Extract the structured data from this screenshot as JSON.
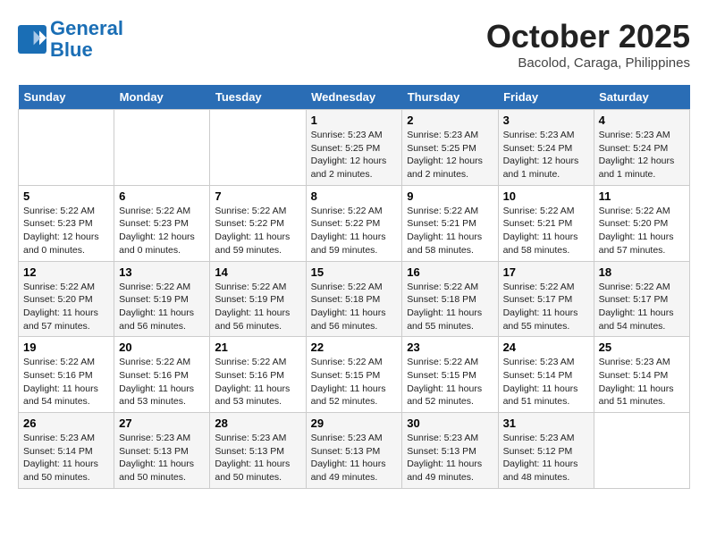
{
  "header": {
    "logo_line1": "General",
    "logo_line2": "Blue",
    "title": "October 2025",
    "subtitle": "Bacolod, Caraga, Philippines"
  },
  "days_of_week": [
    "Sunday",
    "Monday",
    "Tuesday",
    "Wednesday",
    "Thursday",
    "Friday",
    "Saturday"
  ],
  "weeks": [
    [
      {
        "day": "",
        "info": ""
      },
      {
        "day": "",
        "info": ""
      },
      {
        "day": "",
        "info": ""
      },
      {
        "day": "1",
        "info": "Sunrise: 5:23 AM\nSunset: 5:25 PM\nDaylight: 12 hours\nand 2 minutes."
      },
      {
        "day": "2",
        "info": "Sunrise: 5:23 AM\nSunset: 5:25 PM\nDaylight: 12 hours\nand 2 minutes."
      },
      {
        "day": "3",
        "info": "Sunrise: 5:23 AM\nSunset: 5:24 PM\nDaylight: 12 hours\nand 1 minute."
      },
      {
        "day": "4",
        "info": "Sunrise: 5:23 AM\nSunset: 5:24 PM\nDaylight: 12 hours\nand 1 minute."
      }
    ],
    [
      {
        "day": "5",
        "info": "Sunrise: 5:22 AM\nSunset: 5:23 PM\nDaylight: 12 hours\nand 0 minutes."
      },
      {
        "day": "6",
        "info": "Sunrise: 5:22 AM\nSunset: 5:23 PM\nDaylight: 12 hours\nand 0 minutes."
      },
      {
        "day": "7",
        "info": "Sunrise: 5:22 AM\nSunset: 5:22 PM\nDaylight: 11 hours\nand 59 minutes."
      },
      {
        "day": "8",
        "info": "Sunrise: 5:22 AM\nSunset: 5:22 PM\nDaylight: 11 hours\nand 59 minutes."
      },
      {
        "day": "9",
        "info": "Sunrise: 5:22 AM\nSunset: 5:21 PM\nDaylight: 11 hours\nand 58 minutes."
      },
      {
        "day": "10",
        "info": "Sunrise: 5:22 AM\nSunset: 5:21 PM\nDaylight: 11 hours\nand 58 minutes."
      },
      {
        "day": "11",
        "info": "Sunrise: 5:22 AM\nSunset: 5:20 PM\nDaylight: 11 hours\nand 57 minutes."
      }
    ],
    [
      {
        "day": "12",
        "info": "Sunrise: 5:22 AM\nSunset: 5:20 PM\nDaylight: 11 hours\nand 57 minutes."
      },
      {
        "day": "13",
        "info": "Sunrise: 5:22 AM\nSunset: 5:19 PM\nDaylight: 11 hours\nand 56 minutes."
      },
      {
        "day": "14",
        "info": "Sunrise: 5:22 AM\nSunset: 5:19 PM\nDaylight: 11 hours\nand 56 minutes."
      },
      {
        "day": "15",
        "info": "Sunrise: 5:22 AM\nSunset: 5:18 PM\nDaylight: 11 hours\nand 56 minutes."
      },
      {
        "day": "16",
        "info": "Sunrise: 5:22 AM\nSunset: 5:18 PM\nDaylight: 11 hours\nand 55 minutes."
      },
      {
        "day": "17",
        "info": "Sunrise: 5:22 AM\nSunset: 5:17 PM\nDaylight: 11 hours\nand 55 minutes."
      },
      {
        "day": "18",
        "info": "Sunrise: 5:22 AM\nSunset: 5:17 PM\nDaylight: 11 hours\nand 54 minutes."
      }
    ],
    [
      {
        "day": "19",
        "info": "Sunrise: 5:22 AM\nSunset: 5:16 PM\nDaylight: 11 hours\nand 54 minutes."
      },
      {
        "day": "20",
        "info": "Sunrise: 5:22 AM\nSunset: 5:16 PM\nDaylight: 11 hours\nand 53 minutes."
      },
      {
        "day": "21",
        "info": "Sunrise: 5:22 AM\nSunset: 5:16 PM\nDaylight: 11 hours\nand 53 minutes."
      },
      {
        "day": "22",
        "info": "Sunrise: 5:22 AM\nSunset: 5:15 PM\nDaylight: 11 hours\nand 52 minutes."
      },
      {
        "day": "23",
        "info": "Sunrise: 5:22 AM\nSunset: 5:15 PM\nDaylight: 11 hours\nand 52 minutes."
      },
      {
        "day": "24",
        "info": "Sunrise: 5:23 AM\nSunset: 5:14 PM\nDaylight: 11 hours\nand 51 minutes."
      },
      {
        "day": "25",
        "info": "Sunrise: 5:23 AM\nSunset: 5:14 PM\nDaylight: 11 hours\nand 51 minutes."
      }
    ],
    [
      {
        "day": "26",
        "info": "Sunrise: 5:23 AM\nSunset: 5:14 PM\nDaylight: 11 hours\nand 50 minutes."
      },
      {
        "day": "27",
        "info": "Sunrise: 5:23 AM\nSunset: 5:13 PM\nDaylight: 11 hours\nand 50 minutes."
      },
      {
        "day": "28",
        "info": "Sunrise: 5:23 AM\nSunset: 5:13 PM\nDaylight: 11 hours\nand 50 minutes."
      },
      {
        "day": "29",
        "info": "Sunrise: 5:23 AM\nSunset: 5:13 PM\nDaylight: 11 hours\nand 49 minutes."
      },
      {
        "day": "30",
        "info": "Sunrise: 5:23 AM\nSunset: 5:13 PM\nDaylight: 11 hours\nand 49 minutes."
      },
      {
        "day": "31",
        "info": "Sunrise: 5:23 AM\nSunset: 5:12 PM\nDaylight: 11 hours\nand 48 minutes."
      },
      {
        "day": "",
        "info": ""
      }
    ]
  ]
}
